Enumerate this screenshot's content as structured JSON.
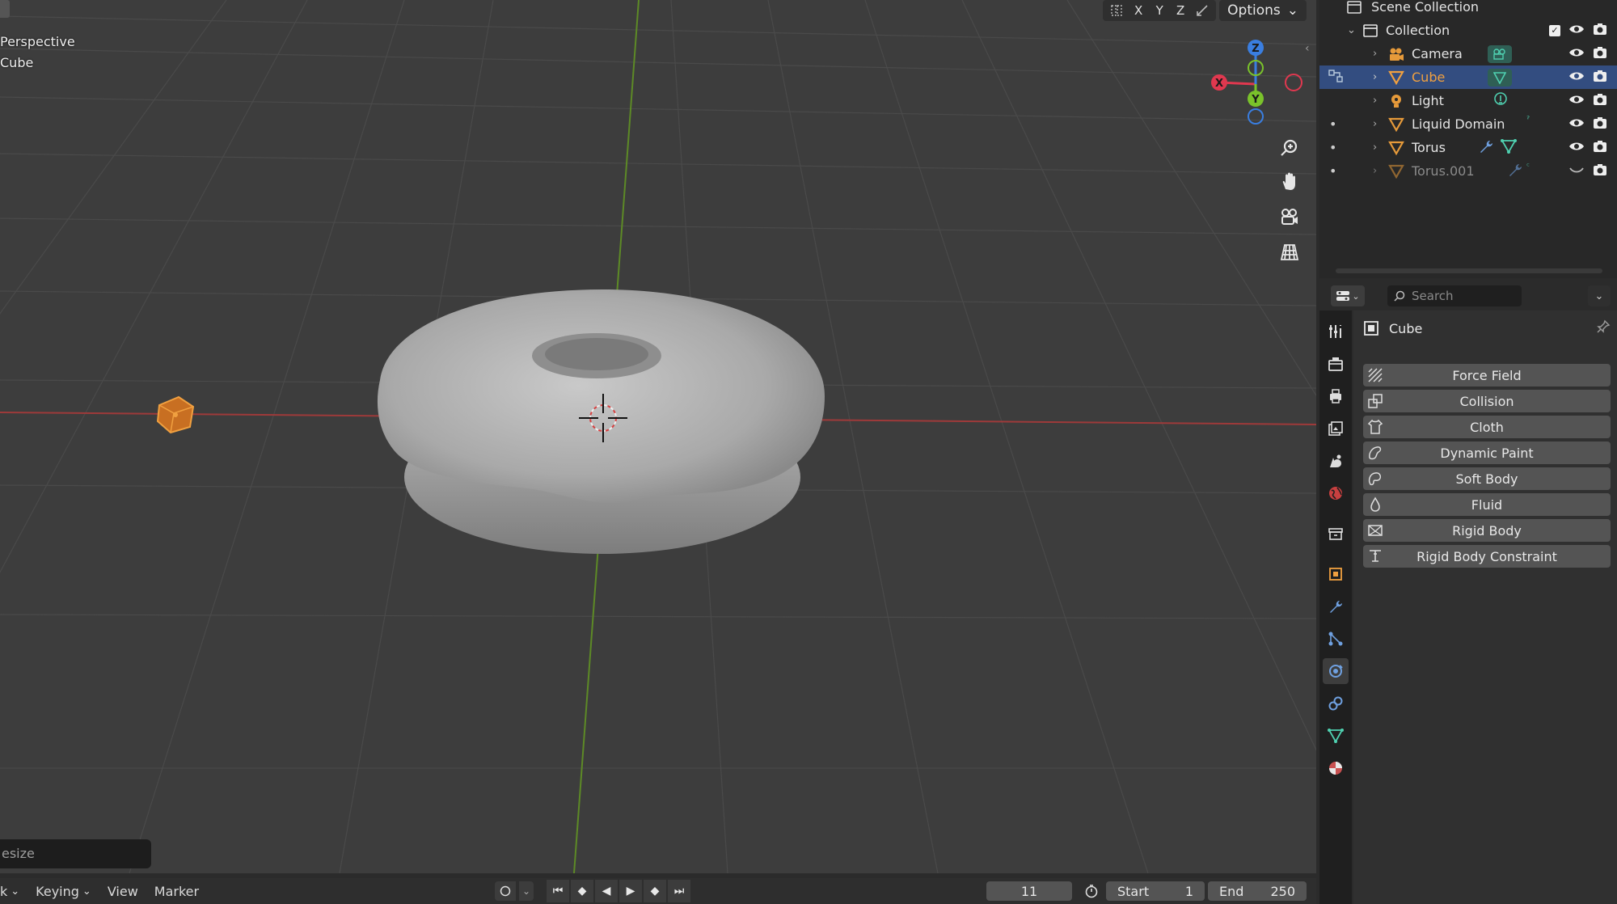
{
  "viewport": {
    "view_name": "Perspective",
    "active_object": "Cube",
    "header": {
      "axes": [
        "X",
        "Y",
        "Z"
      ],
      "options_label": "Options"
    },
    "gizmo": {
      "x": "X",
      "y": "Y",
      "z": "Z"
    },
    "resize_popup": "esize"
  },
  "timeline": {
    "menu": {
      "first": "k",
      "keying": "Keying",
      "view": "View",
      "marker": "Marker"
    },
    "current_frame": "11",
    "start_label": "Start",
    "start_value": "1",
    "end_label": "End",
    "end_value": "250"
  },
  "outliner": {
    "scene_collection": "Scene Collection",
    "collection": "Collection",
    "items": [
      {
        "label": "Camera",
        "icon": "camera-icon",
        "color": "#e8e8e8"
      },
      {
        "label": "Cube",
        "icon": "mesh-icon",
        "color": "#f0a040",
        "selected": true
      },
      {
        "label": "Light",
        "icon": "light-icon",
        "color": "#e8e8e8"
      },
      {
        "label": "Liquid Domain",
        "icon": "mesh-icon",
        "color": "#e8e8e8"
      },
      {
        "label": "Torus",
        "icon": "mesh-icon",
        "color": "#e8e8e8"
      },
      {
        "label": "Torus.001",
        "icon": "mesh-icon",
        "color": "#8a8a8a"
      }
    ]
  },
  "properties": {
    "search_placeholder": "Search",
    "object_name": "Cube",
    "physics_buttons": [
      {
        "label": "Force Field",
        "icon": "force-field-icon"
      },
      {
        "label": "Collision",
        "icon": "collision-icon"
      },
      {
        "label": "Cloth",
        "icon": "cloth-icon"
      },
      {
        "label": "Dynamic Paint",
        "icon": "dynamic-paint-icon"
      },
      {
        "label": "Soft Body",
        "icon": "soft-body-icon"
      },
      {
        "label": "Fluid",
        "icon": "fluid-icon"
      },
      {
        "label": "Rigid Body",
        "icon": "rigid-body-icon"
      },
      {
        "label": "Rigid Body Constraint",
        "icon": "rigid-body-constraint-icon"
      }
    ]
  },
  "colors": {
    "accent_selected": "#334d80",
    "object_orange": "#f0a040",
    "axis_x": "#e0384f",
    "axis_y": "#7ac22b",
    "axis_z": "#3a7ee0"
  }
}
